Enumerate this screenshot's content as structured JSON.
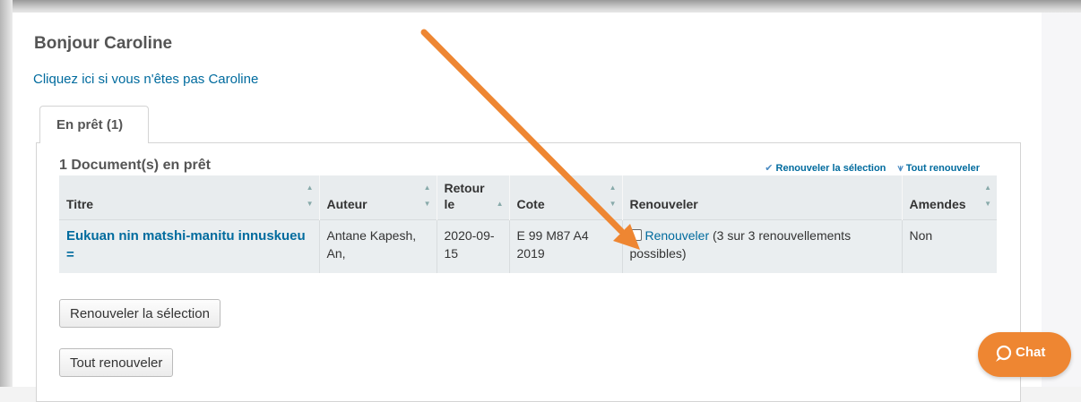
{
  "greeting": "Bonjour Caroline",
  "not_you_link": "Cliquez ici si vous n'êtes pas Caroline",
  "tab_label": "En prêt (1)",
  "checkouts_heading": "1 Document(s) en prêt",
  "toolbar": {
    "renew_selected": "Renouveler la sélection",
    "renew_all": "Tout renouveler"
  },
  "table": {
    "headers": {
      "title": "Titre",
      "author": "Auteur",
      "due_line1": "Retour",
      "due_line2": "le",
      "call_number": "Cote",
      "renew": "Renouveler",
      "fines": "Amendes"
    },
    "rows": [
      {
        "title": "Eukuan nin matshi-manitu innuskueu =",
        "author": "Antane Kapesh, An,",
        "due": "2020-09-15",
        "call_number": "E 99 M87 A4 2019",
        "renew_link": "Renouveler",
        "renew_note": "(3 sur 3 renouvellements possibles)",
        "fines": "Non"
      }
    ]
  },
  "buttons": {
    "renew_selected": "Renouveler la sélection",
    "renew_all": "Tout renouveler"
  },
  "chat_label": "Chat",
  "colors": {
    "link": "#006b9e",
    "arrow": "#ee8632",
    "chat": "#ee8632"
  }
}
